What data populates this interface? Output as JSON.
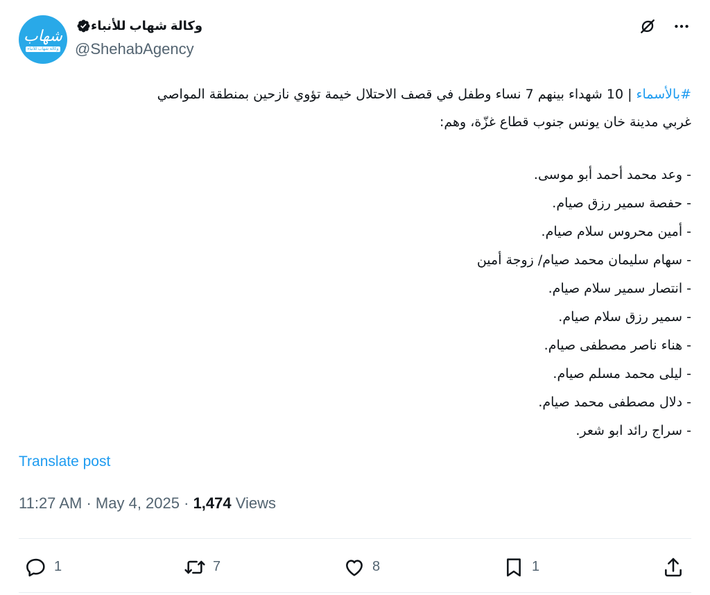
{
  "author": {
    "display_name": "وكالة شهاب للأنباء",
    "handle": "@ShehabAgency",
    "verified": true,
    "avatar_text": "شهاب",
    "avatar_subtext": "وكالة شهاب للأنباء",
    "avatar_color": "#29a9e8"
  },
  "post": {
    "hashtag": "#بالأسماء",
    "intro_line1_rest": " | 10 شهداء بينهم 7 نساء وطفل في قصف الاحتلال خيمة تؤوي نازحين بمنطقة المواصي",
    "intro_line2": "غربي مدينة خان يونس جنوب قطاع غزّة، وهم:",
    "names": [
      "- وعد محمد أحمد أبو موسى.",
      "- حفصة سمير رزق صيام.",
      "- أمين محروس سلام صيام.",
      "- سهام سليمان محمد صيام/ زوجة أمين",
      "- انتصار سمير سلام صيام.",
      "- سمير رزق سلام صيام.",
      "- هناء ناصر مصطفى صيام.",
      "- ليلى محمد مسلم صيام.",
      "- دلال مصطفى محمد صيام.",
      "- سراج رائد ابو شعر."
    ],
    "translate_label": "Translate post",
    "time": "11:27 AM",
    "date": "May 4, 2025",
    "separator": "·",
    "views_count": "1,474",
    "views_label": "Views"
  },
  "actions": {
    "replies": "1",
    "reposts": "7",
    "likes": "8",
    "bookmarks": "1"
  },
  "icons": {
    "grok": "grok-icon",
    "more": "more-icon",
    "reply": "reply-icon",
    "repost": "repost-icon",
    "like": "heart-icon",
    "bookmark": "bookmark-icon",
    "share": "share-icon"
  },
  "colors": {
    "link": "#1d9bf0",
    "secondary_text": "#536471",
    "primary_text": "#0f1419"
  }
}
